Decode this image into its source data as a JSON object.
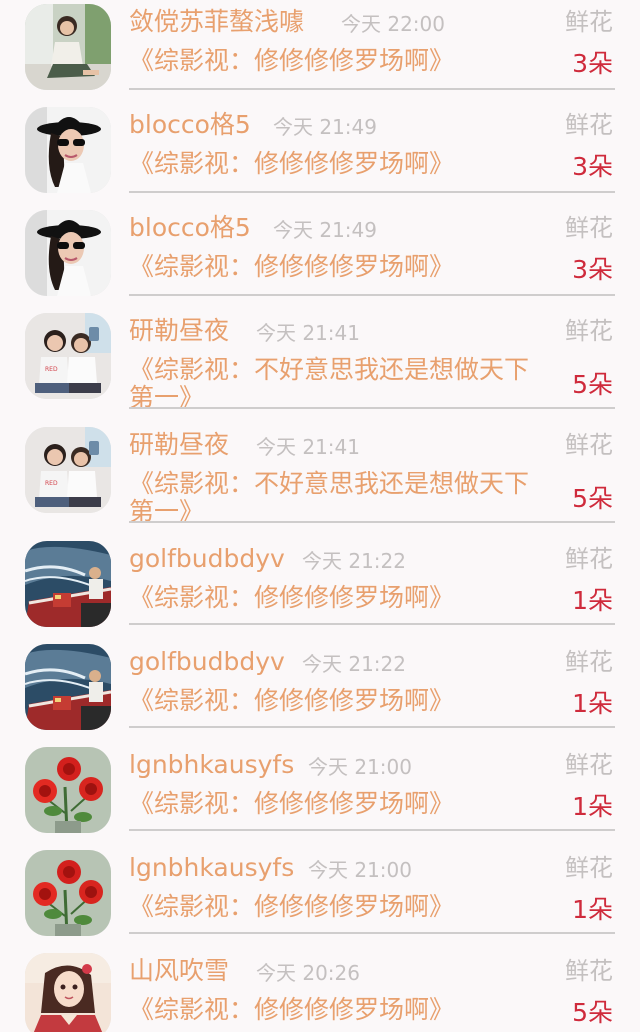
{
  "gift_list": [
    {
      "name": "敛傥苏菲螯浅噱",
      "time": "今天 22:00",
      "gift_type": "鲜花",
      "message": "《综影视：修修修修罗场啊》",
      "count": "3朵",
      "avatar": "woman-sitting-photo"
    },
    {
      "name": "blocco格5",
      "time": "今天 21:49",
      "gift_type": "鲜花",
      "message": "《综影视：修修修修罗场啊》",
      "count": "3朵",
      "avatar": "woman-black-hat-photo"
    },
    {
      "name": "blocco格5",
      "time": "今天 21:49",
      "gift_type": "鲜花",
      "message": "《综影视：修修修修罗场啊》",
      "count": "3朵",
      "avatar": "woman-black-hat-photo"
    },
    {
      "name": "研勒昼夜",
      "time": "今天 21:41",
      "gift_type": "鲜花",
      "message": "《综影视：不好意思我还是想做天下第一》",
      "count": "5朵",
      "avatar": "couple-selfie-photo"
    },
    {
      "name": "研勒昼夜",
      "time": "今天 21:41",
      "gift_type": "鲜花",
      "message": "《综影视：不好意思我还是想做天下第一》",
      "count": "5朵",
      "avatar": "couple-selfie-photo"
    },
    {
      "name": "golfbudbdyv",
      "time": "今天 21:22",
      "gift_type": "鲜花",
      "message": "《综影视：修修修修罗场啊》",
      "count": "1朵",
      "avatar": "boat-water-photo"
    },
    {
      "name": "golfbudbdyv",
      "time": "今天 21:22",
      "gift_type": "鲜花",
      "message": "《综影视：修修修修罗场啊》",
      "count": "1朵",
      "avatar": "boat-water-photo"
    },
    {
      "name": "lgnbhkausyfs",
      "time": "今天 21:00",
      "gift_type": "鲜花",
      "message": "《综影视：修修修修罗场啊》",
      "count": "1朵",
      "avatar": "red-roses-image"
    },
    {
      "name": "lgnbhkausyfs",
      "time": "今天 21:00",
      "gift_type": "鲜花",
      "message": "《综影视：修修修修罗场啊》",
      "count": "1朵",
      "avatar": "red-roses-image"
    },
    {
      "name": "山风吹雪",
      "time": "今天 20:26",
      "gift_type": "鲜花",
      "message": "《综影视：修修修修罗场啊》",
      "count": "5朵",
      "avatar": "anime-girl-image"
    }
  ]
}
